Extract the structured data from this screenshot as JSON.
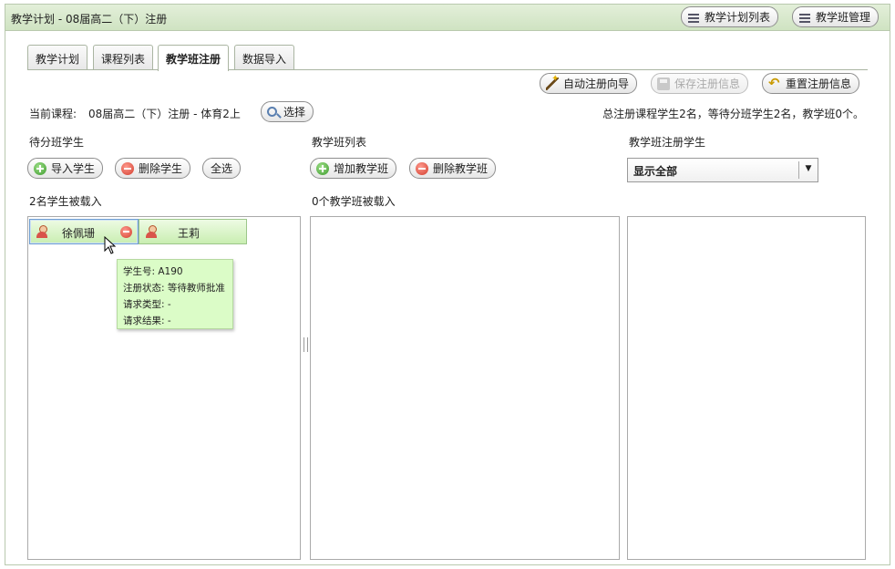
{
  "window": {
    "title": "教学计划 - 08届高二（下）注册",
    "buttons": [
      "教学计划列表",
      "教学班管理"
    ]
  },
  "tabs": [
    "教学计划",
    "课程列表",
    "教学班注册",
    "数据导入"
  ],
  "active_tab": "教学班注册",
  "toolbar": {
    "auto_register": "自动注册向导",
    "save_register": "保存注册信息",
    "reset_register": "重置注册信息"
  },
  "course": {
    "label": "当前课程:",
    "value": "08届高二（下）注册 - 体育2上",
    "select_button": "选择"
  },
  "summary": "总注册课程学生2名，等待分班学生2名，教学班0个。",
  "pending": {
    "header": "待分班学生",
    "import_button": "导入学生",
    "delete_button": "删除学生",
    "select_all_button": "全选",
    "count_text": "2名学生被载入",
    "students": [
      "徐佩珊",
      "王莉"
    ]
  },
  "classes": {
    "header": "教学班列表",
    "add_button": "增加教学班",
    "delete_button": "删除教学班",
    "count_text": "0个教学班被载入"
  },
  "registered": {
    "header": "教学班注册学生",
    "filter_value": "显示全部"
  },
  "tooltip": {
    "student_no": "学生号: A190",
    "status": "注册状态: 等待教师批准",
    "request_type": "请求类型: -",
    "request_result": "请求结果: -"
  }
}
